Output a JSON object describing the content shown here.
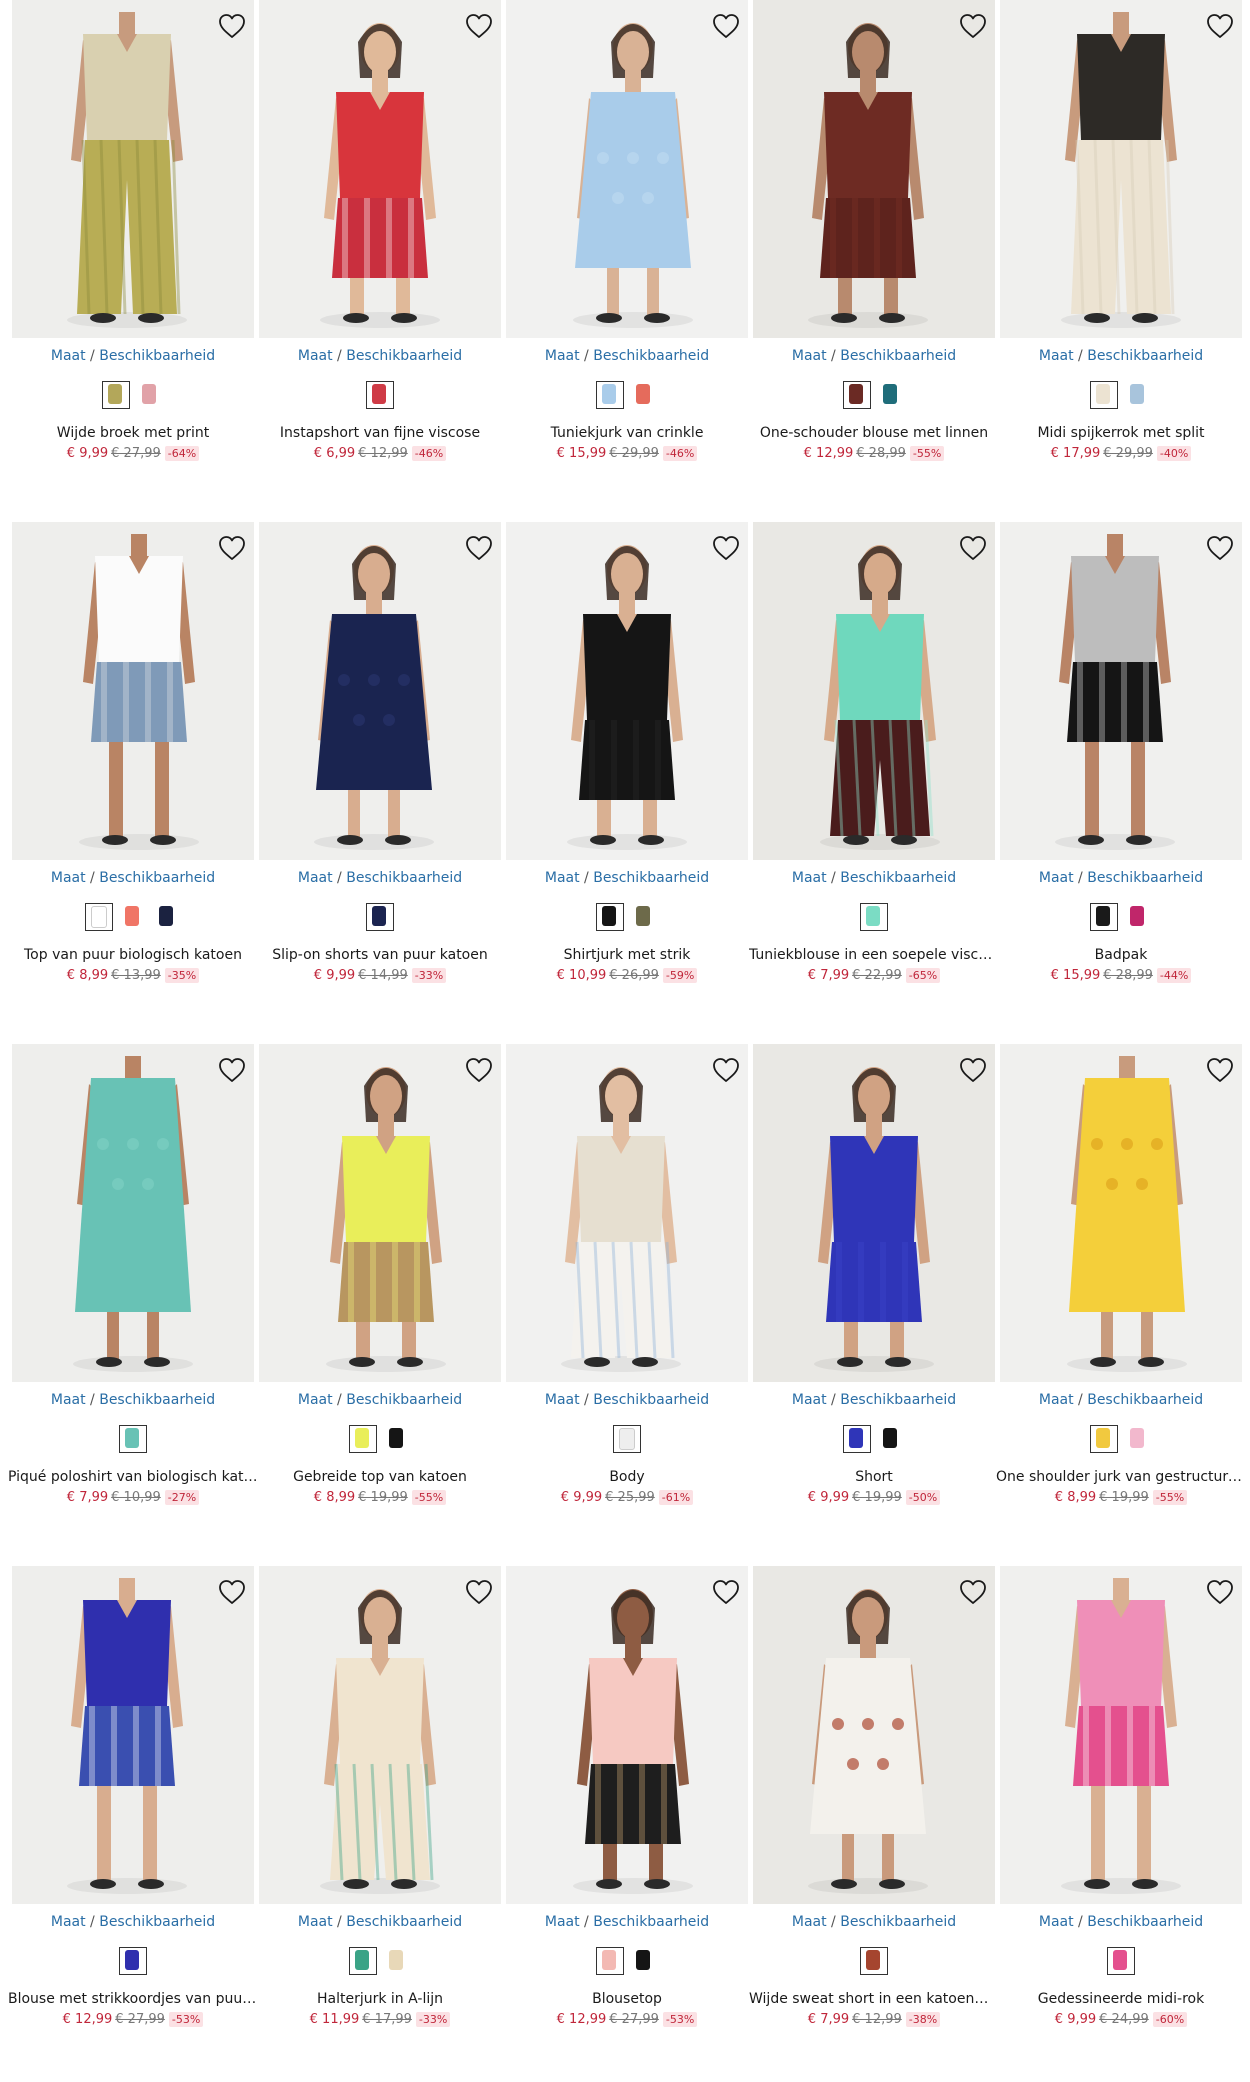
{
  "availability": {
    "size": "Maat",
    "separator": "/",
    "availability": "Beschikbaarheid"
  },
  "icons": {
    "wishlist": "heart-outline-icon"
  },
  "products": [
    {
      "name": "Wijde broek met print",
      "price": "€ 9,99",
      "old_price": "€ 27,99",
      "discount": "-64%",
      "photo": {
        "bg": "#eeeeec",
        "top": "#d9d0b0",
        "bottom": "#b8ad55",
        "pattern": "#8a8a3a",
        "skin": "#c79b7e"
      },
      "swatches": [
        {
          "color": "#b3a75a",
          "selected": true
        },
        {
          "color": "#e1a2a8",
          "selected": false
        }
      ]
    },
    {
      "name": "Instapshort van fijne viscose",
      "price": "€ 6,99",
      "old_price": "€ 12,99",
      "discount": "-46%",
      "photo": {
        "bg": "#efefed",
        "top": "#d8353c",
        "bottom": "#c92f3e",
        "pattern": "#ffffff",
        "skin": "#e0b999"
      },
      "swatches": [
        {
          "color": "#cf3b46",
          "selected": true
        }
      ]
    },
    {
      "name": "Tuniekjurk van crinkle",
      "price": "€ 15,99",
      "old_price": "€ 29,99",
      "discount": "-46%",
      "photo": {
        "bg": "#f1f1f0",
        "top": "#a9ccea",
        "bottom": "#a9ccea",
        "pattern": "#bcd8f0",
        "skin": "#d9b295"
      },
      "swatches": [
        {
          "color": "#a9ccea",
          "selected": true
        },
        {
          "color": "#e56b5c",
          "selected": false
        }
      ]
    },
    {
      "name": "One-schouder blouse met linnen",
      "price": "€ 12,99",
      "old_price": "€ 28,99",
      "discount": "-55%",
      "photo": {
        "bg": "#e9e8e4",
        "top": "#6e2b23",
        "bottom": "#5e231d",
        "pattern": "#7d3329",
        "skin": "#b88a6e"
      },
      "swatches": [
        {
          "color": "#6b2a24",
          "selected": true
        },
        {
          "color": "#1f6d7a",
          "selected": false
        }
      ]
    },
    {
      "name": "Midi spijkerrok met split",
      "price": "€ 17,99",
      "old_price": "€ 29,99",
      "discount": "-40%",
      "photo": {
        "bg": "#f0f0ee",
        "top": "#2d2a26",
        "bottom": "#ece3d2",
        "pattern": "#d8cdb8",
        "skin": "#c89b7d"
      },
      "swatches": [
        {
          "color": "#ece3d2",
          "selected": true
        },
        {
          "color": "#a8c4dc",
          "selected": false
        }
      ]
    },
    {
      "name": "Top van puur biologisch katoen",
      "price": "€ 8,99",
      "old_price": "€ 13,99",
      "discount": "-35%",
      "photo": {
        "bg": "#eeeeec",
        "top": "#fbfbfb",
        "bottom": "#7f9ab8",
        "pattern": "#e6e6e6",
        "skin": "#b98464"
      },
      "swatches": [
        {
          "color": "#ffffff",
          "selected": true
        },
        {
          "color": "#f07566",
          "selected": false
        },
        {
          "color": "#1b2240",
          "selected": false
        }
      ]
    },
    {
      "name": "Slip-on shorts van puur katoen",
      "price": "€ 9,99",
      "old_price": "€ 14,99",
      "discount": "-33%",
      "photo": {
        "bg": "#efefed",
        "top": "#1a2450",
        "bottom": "#1a2450",
        "pattern": "#28336a",
        "skin": "#d8ad8f"
      },
      "swatches": [
        {
          "color": "#1b2450",
          "selected": true
        }
      ]
    },
    {
      "name": "Shirtjurk met strik",
      "price": "€ 10,99",
      "old_price": "€ 26,99",
      "discount": "-59%",
      "photo": {
        "bg": "#f1f1f0",
        "top": "#151515",
        "bottom": "#151515",
        "pattern": "#2a2a2a",
        "skin": "#d9b092"
      },
      "swatches": [
        {
          "color": "#151515",
          "selected": true
        },
        {
          "color": "#6d6a4a",
          "selected": false
        }
      ]
    },
    {
      "name": "Tuniekblouse in een soepele viscose",
      "price": "€ 7,99",
      "old_price": "€ 22,99",
      "discount": "-65%",
      "photo": {
        "bg": "#e9e8e4",
        "top": "#6fd8bd",
        "bottom": "#4a1c1c",
        "pattern": "#8fe3cd",
        "skin": "#d6aa8a"
      },
      "swatches": [
        {
          "color": "#7bdcc4",
          "selected": true
        }
      ]
    },
    {
      "name": "Badpak",
      "price": "€ 15,99",
      "old_price": "€ 28,99",
      "discount": "-44%",
      "photo": {
        "bg": "#f0f0ee",
        "top": "#bdbdbd",
        "bottom": "#151515",
        "pattern": "#e4e4e4",
        "skin": "#b98466"
      },
      "swatches": [
        {
          "color": "#1a1a1a",
          "selected": true
        },
        {
          "color": "#c0266a",
          "selected": false
        }
      ]
    },
    {
      "name": "Piqué poloshirt van biologisch katoen",
      "price": "€ 7,99",
      "old_price": "€ 10,99",
      "discount": "-27%",
      "photo": {
        "bg": "#eeeeec",
        "top": "#68c2b5",
        "bottom": "#1b1b1b",
        "pattern": "#7ccec2",
        "skin": "#b98464"
      },
      "swatches": [
        {
          "color": "#68c2b5",
          "selected": true
        }
      ]
    },
    {
      "name": "Gebreide top van katoen",
      "price": "€ 8,99",
      "old_price": "€ 19,99",
      "discount": "-55%",
      "photo": {
        "bg": "#efefed",
        "top": "#e9ee5a",
        "bottom": "#b89660",
        "pattern": "#f1f47f",
        "skin": "#d0a283"
      },
      "swatches": [
        {
          "color": "#e9ee5a",
          "selected": true
        },
        {
          "color": "#151515",
          "selected": false
        }
      ]
    },
    {
      "name": "Body",
      "price": "€ 9,99",
      "old_price": "€ 25,99",
      "discount": "-61%",
      "photo": {
        "bg": "#f1f1f0",
        "top": "#e6dfd0",
        "bottom": "#f4f2ee",
        "pattern": "#8fb2d8",
        "skin": "#e2bea2"
      },
      "swatches": [
        {
          "color": "#eeeeee",
          "selected": true
        }
      ]
    },
    {
      "name": "Short",
      "price": "€ 9,99",
      "old_price": "€ 19,99",
      "discount": "-50%",
      "photo": {
        "bg": "#e9e8e4",
        "top": "#2f35b8",
        "bottom": "#2f35b8",
        "pattern": "#4047cc",
        "skin": "#d0a283"
      },
      "swatches": [
        {
          "color": "#2f35b8",
          "selected": true
        },
        {
          "color": "#151515",
          "selected": false
        }
      ]
    },
    {
      "name": "One shoulder jurk van gestructureerde stof",
      "price": "€ 8,99",
      "old_price": "€ 19,99",
      "discount": "-55%",
      "photo": {
        "bg": "#f0f0ee",
        "top": "#f4cf3a",
        "bottom": "#f8e7a8",
        "pattern": "#e0a51e",
        "skin": "#c89b7d"
      },
      "swatches": [
        {
          "color": "#f1c93f",
          "selected": true
        },
        {
          "color": "#f2b8cd",
          "selected": false
        }
      ]
    },
    {
      "name": "Blouse met strikkoordjes van puur katoen",
      "price": "€ 12,99",
      "old_price": "€ 27,99",
      "discount": "-53%",
      "photo": {
        "bg": "#eeeeec",
        "top": "#2f2fae",
        "bottom": "#3a4fb0",
        "pattern": "#ffffff",
        "skin": "#d8ad8f"
      },
      "swatches": [
        {
          "color": "#2f2fae",
          "selected": true
        }
      ]
    },
    {
      "name": "Halterjurk in A-lijn",
      "price": "€ 11,99",
      "old_price": "€ 17,99",
      "discount": "-33%",
      "photo": {
        "bg": "#efefed",
        "top": "#f0e4cf",
        "bottom": "#f0e4cf",
        "pattern": "#3aa386",
        "skin": "#d9b092"
      },
      "swatches": [
        {
          "color": "#3aa386",
          "selected": true
        },
        {
          "color": "#e8d8b8",
          "selected": false
        }
      ]
    },
    {
      "name": "Blousetop",
      "price": "€ 12,99",
      "old_price": "€ 27,99",
      "discount": "-53%",
      "photo": {
        "bg": "#f1f1f0",
        "top": "#f6c9c2",
        "bottom": "#1e1e1e",
        "pattern": "#d8b077",
        "skin": "#8e5c43"
      },
      "swatches": [
        {
          "color": "#f3b9b3",
          "selected": true
        },
        {
          "color": "#151515",
          "selected": false
        }
      ]
    },
    {
      "name": "Wijde sweat short in een katoenmix",
      "price": "€ 7,99",
      "old_price": "€ 12,99",
      "discount": "-38%",
      "photo": {
        "bg": "#e9e8e4",
        "top": "#f3f1ec",
        "bottom": "#9a3e2a",
        "pattern": "#ad4a33",
        "skin": "#c99a7c"
      },
      "swatches": [
        {
          "color": "#a5452f",
          "selected": true
        }
      ]
    },
    {
      "name": "Gedessineerde midi-rok",
      "price": "€ 9,99",
      "old_price": "€ 24,99",
      "discount": "-60%",
      "photo": {
        "bg": "#f0f0ee",
        "top": "#ef8fb8",
        "bottom": "#e4508e",
        "pattern": "#ffffff",
        "skin": "#d9b092"
      },
      "swatches": [
        {
          "color": "#e4508e",
          "selected": true
        }
      ]
    }
  ]
}
